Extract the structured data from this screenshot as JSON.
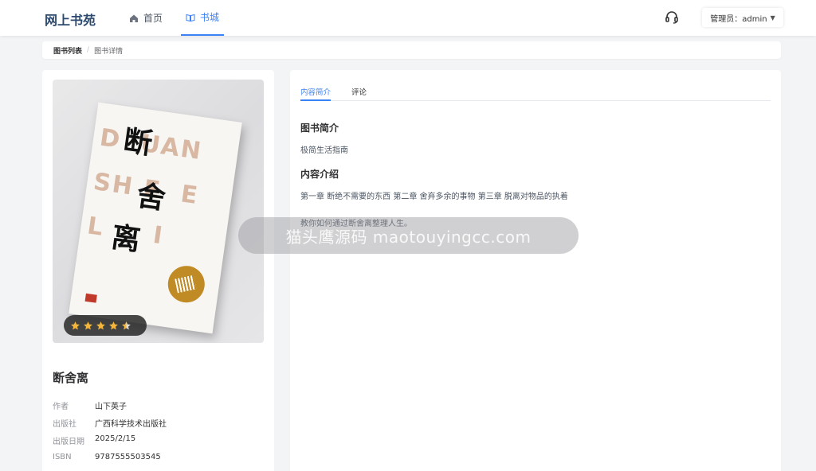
{
  "header": {
    "logo": "网上书苑",
    "nav": [
      {
        "label": "首页",
        "icon": "home-icon"
      },
      {
        "label": "书城",
        "icon": "book-open-icon",
        "active": true
      }
    ],
    "support_icon": "headset-icon",
    "admin_label": "管理员：admin"
  },
  "breadcrumb": [
    "图书列表",
    "图书详情"
  ],
  "book": {
    "cover_title_chars": [
      "断",
      "舍",
      "离"
    ],
    "cover_letters": "DUAN SHE LI",
    "rating": 4.5,
    "rating_max": 5,
    "title": "断舍离",
    "info": [
      {
        "label": "作者",
        "value": "山下英子"
      },
      {
        "label": "出版社",
        "value": "广西科学技术出版社"
      },
      {
        "label": "出版日期",
        "value": "2025/2/15"
      },
      {
        "label": "ISBN",
        "value": "9787555503545"
      }
    ]
  },
  "tabs": [
    "内容简介",
    "评论"
  ],
  "content": {
    "intro_heading": "图书简介",
    "intro_text": "极简生活指南",
    "content_heading": "内容介绍",
    "content_text_1": "第一章 断绝不需要的东西 第二章 舍弃多余的事物 第三章 脱离对物品的执着",
    "content_text_2": "教你如何通过断舍离整理人生。"
  },
  "watermark": "猫头鹰源码 maotouyingcc.com",
  "colors": {
    "accent": "#3b82f6",
    "star": "#f5b73b"
  }
}
